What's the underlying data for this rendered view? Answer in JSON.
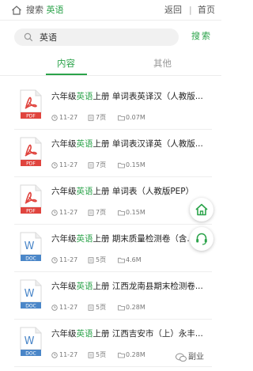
{
  "topbar": {
    "crumb_prefix": "搜索",
    "crumb_keyword": "英语",
    "back": "返回",
    "separator": "|",
    "home": "首页"
  },
  "search": {
    "value": "英语",
    "button": "搜索"
  },
  "tabs": [
    {
      "label": "内容"
    },
    {
      "label": "其他"
    }
  ],
  "items": [
    {
      "type": "PDF",
      "pre": "六年级",
      "kw": "英语",
      "post": "上册 单词表英译汉（人教版...",
      "date": "11-27",
      "pages": "7页",
      "size": "0.07M"
    },
    {
      "type": "PDF",
      "pre": "六年级",
      "kw": "英语",
      "post": "上册 单词表汉译英（人教版...",
      "date": "11-27",
      "pages": "7页",
      "size": "0.15M"
    },
    {
      "type": "PDF",
      "pre": "六年级",
      "kw": "英语",
      "post": "上册 单词表（人教版PEP）",
      "date": "11-27",
      "pages": "7页",
      "size": "0.15M"
    },
    {
      "type": "DOC",
      "pre": "六年级",
      "kw": "英语",
      "post": "上册 期末质量检测卷（含...",
      "date": "11-27",
      "pages": "5页",
      "size": "4.6M"
    },
    {
      "type": "DOC",
      "pre": "六年级",
      "kw": "英语",
      "post": "上册 江西龙南县期末检测卷...",
      "date": "11-27",
      "pages": "5页",
      "size": "0.28M"
    },
    {
      "type": "DOC",
      "pre": "六年级",
      "kw": "英语",
      "post": "上册 江西吉安市（上）永丰...",
      "date": "11-27",
      "pages": "5页",
      "size": "0.28M"
    }
  ],
  "watermark": "副业",
  "colors": {
    "accent": "#2ba34a",
    "pdf": "#e0443e",
    "doc": "#4a86c8"
  },
  "icons": {
    "home": "home-icon",
    "search": "search-icon",
    "clock": "clock-icon",
    "pages": "pages-icon",
    "folder": "folder-icon",
    "headset": "headset-icon"
  }
}
